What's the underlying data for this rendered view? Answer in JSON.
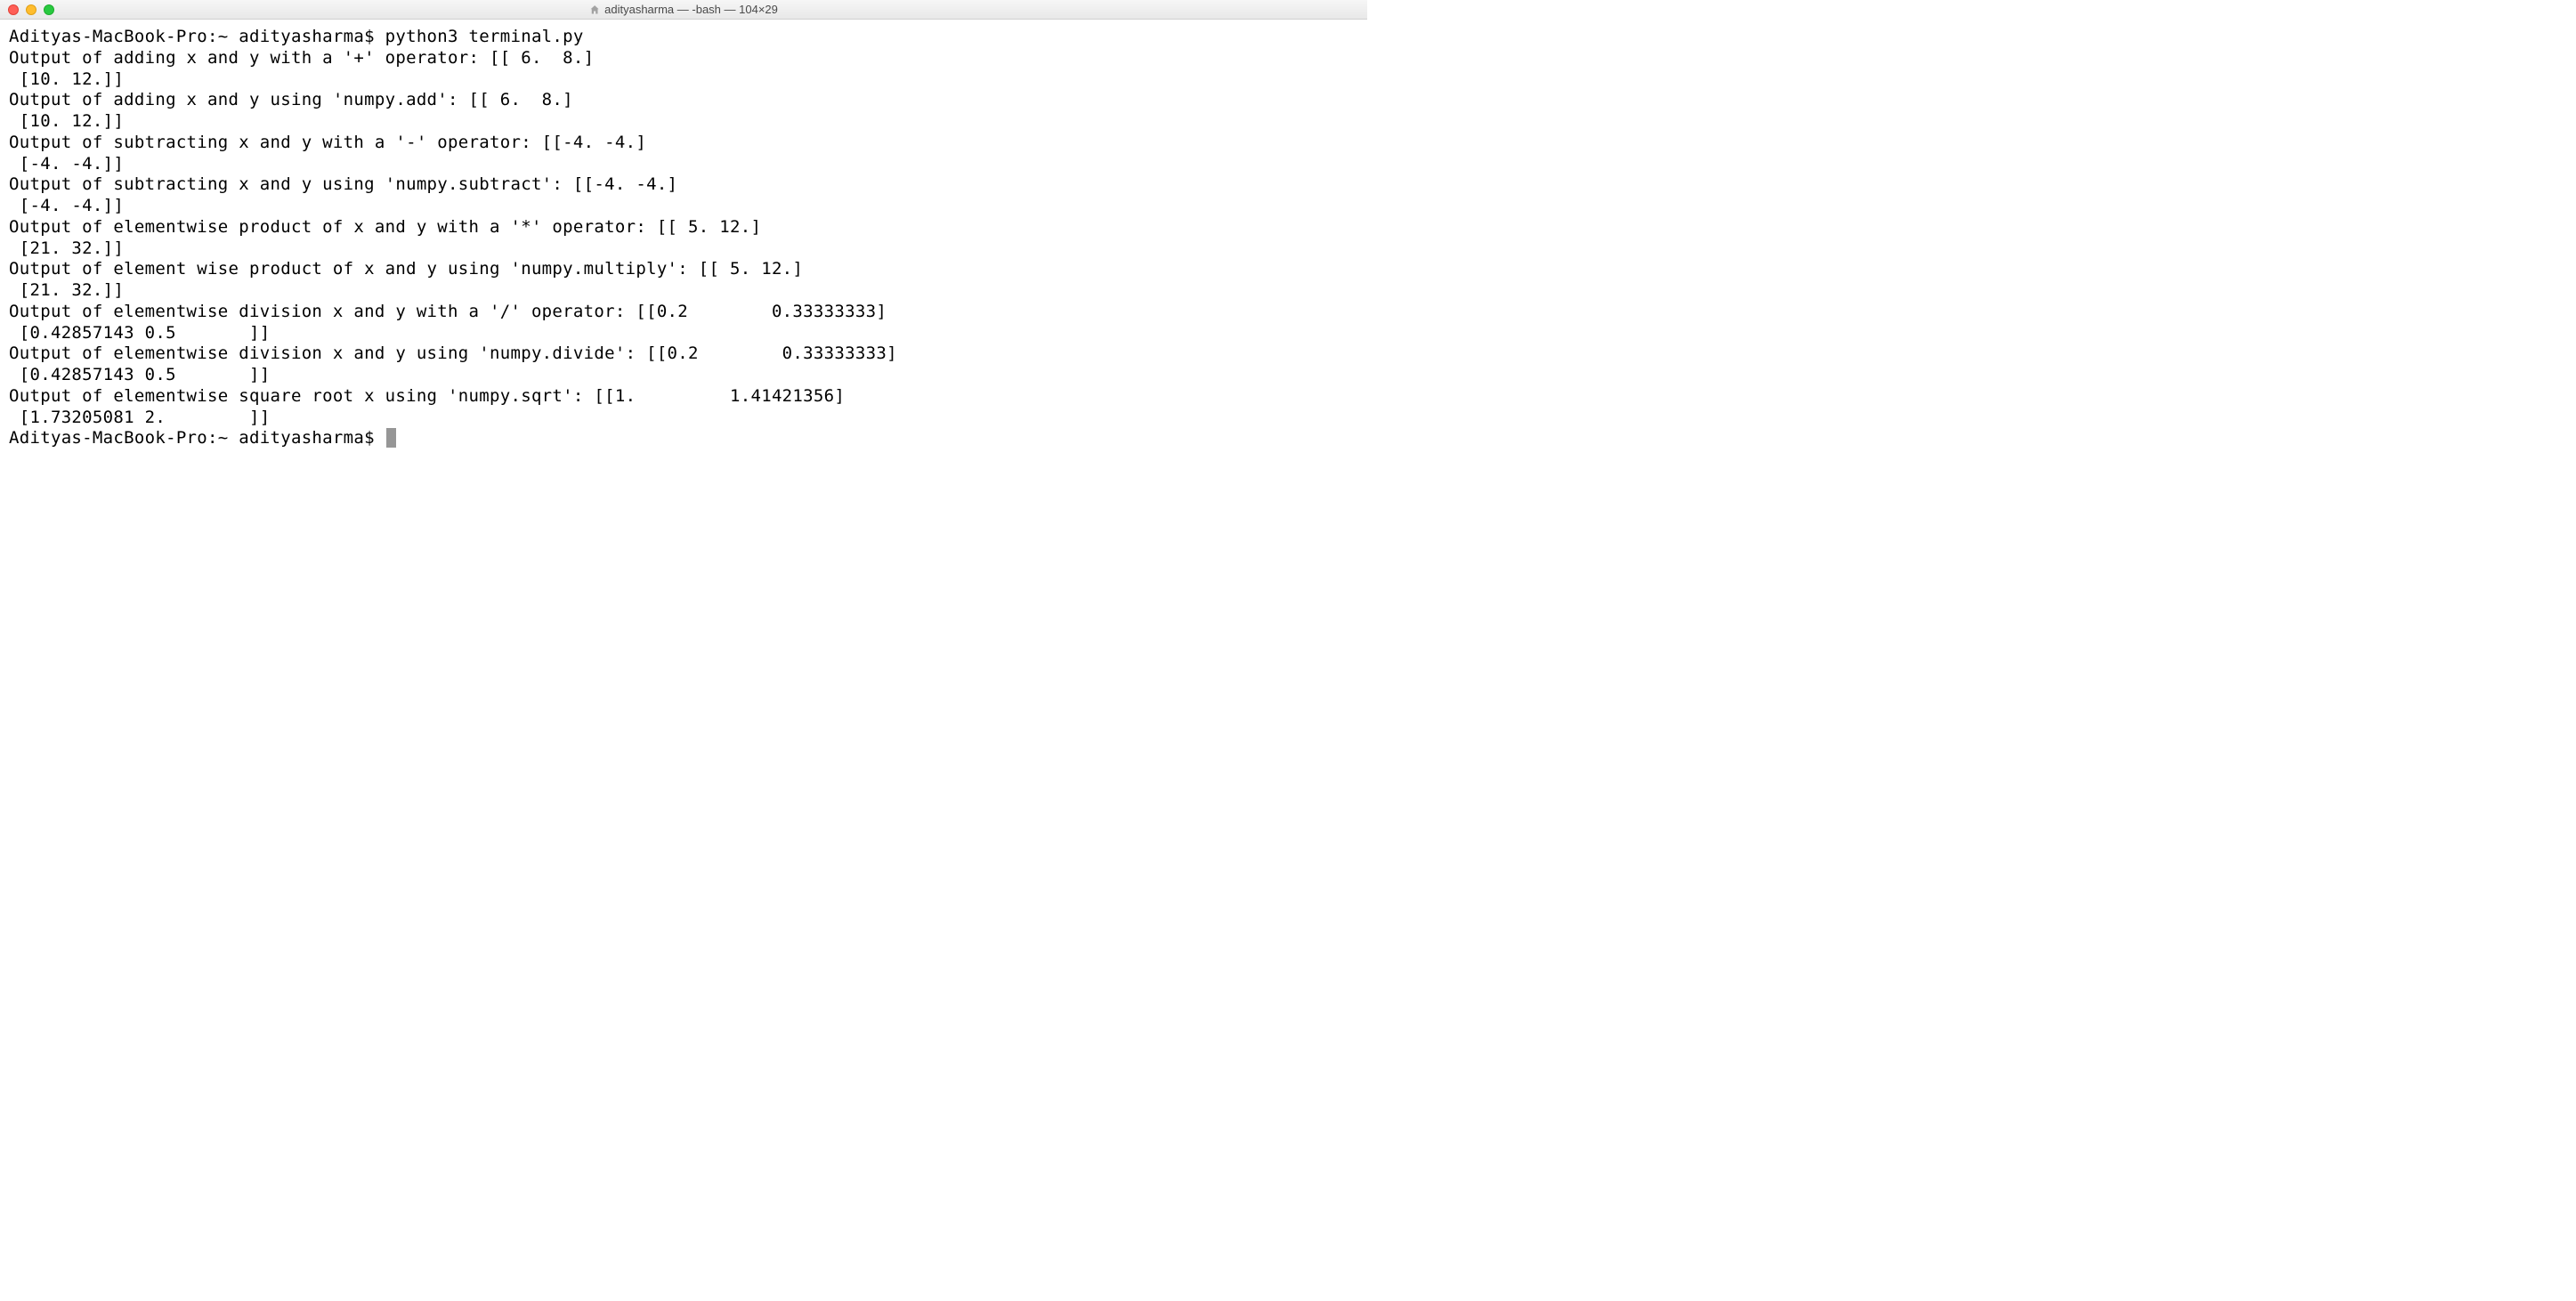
{
  "window": {
    "title": "adityasharma — -bash — 104×29"
  },
  "terminal": {
    "prompt_host": "Adityas-MacBook-Pro:~",
    "prompt_user": "adityasharma$",
    "command": "python3 terminal.py",
    "lines": [
      "Adityas-MacBook-Pro:~ adityasharma$ python3 terminal.py",
      "Output of adding x and y with a '+' operator: [[ 6.  8.]",
      " [10. 12.]]",
      "Output of adding x and y using 'numpy.add': [[ 6.  8.]",
      " [10. 12.]]",
      "Output of subtracting x and y with a '-' operator: [[-4. -4.]",
      " [-4. -4.]]",
      "Output of subtracting x and y using 'numpy.subtract': [[-4. -4.]",
      " [-4. -4.]]",
      "Output of elementwise product of x and y with a '*' operator: [[ 5. 12.]",
      " [21. 32.]]",
      "Output of element wise product of x and y using 'numpy.multiply': [[ 5. 12.]",
      " [21. 32.]]",
      "Output of elementwise division x and y with a '/' operator: [[0.2        0.33333333]",
      " [0.42857143 0.5       ]]",
      "Output of elementwise division x and y using 'numpy.divide': [[0.2        0.33333333]",
      " [0.42857143 0.5       ]]",
      "Output of elementwise square root x using 'numpy.sqrt': [[1.         1.41421356]",
      " [1.73205081 2.        ]]"
    ],
    "final_prompt": "Adityas-MacBook-Pro:~ adityasharma$ "
  }
}
